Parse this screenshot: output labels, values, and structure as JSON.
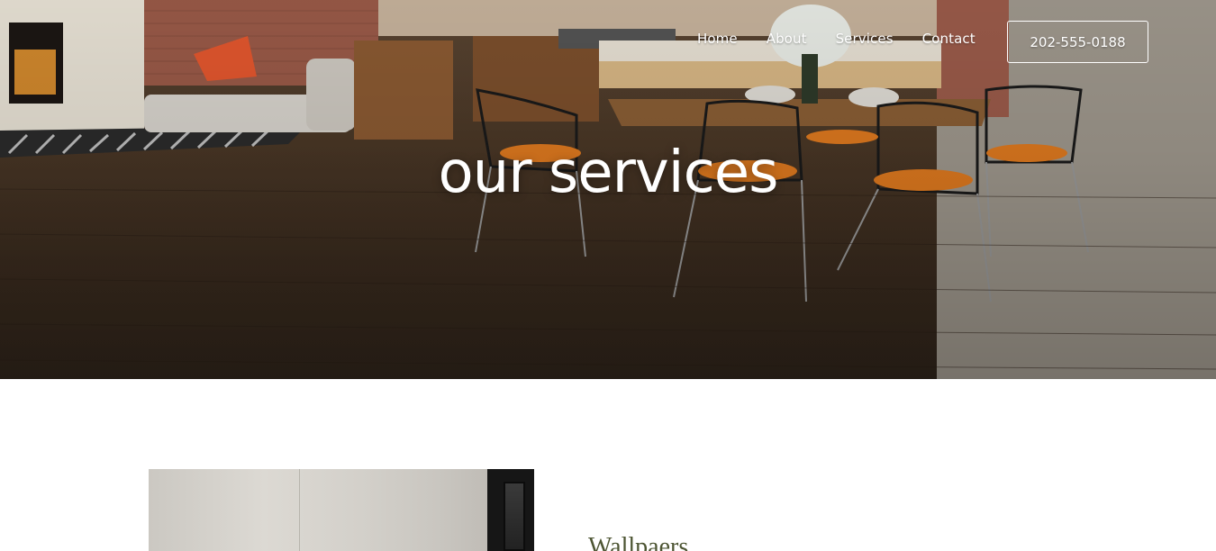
{
  "nav": {
    "items": [
      {
        "label": "Home"
      },
      {
        "label": "About"
      },
      {
        "label": "Services"
      },
      {
        "label": "Contact"
      }
    ],
    "phone_button": "202-555-0188"
  },
  "hero": {
    "title": "our services",
    "image_subject": "modern-kitchen-dining-interior"
  },
  "services": {
    "first": {
      "heading": "Wallpaers",
      "image_subject": "textured-wallpaper-wall"
    }
  },
  "colors": {
    "heading_text": "#4d5533",
    "hero_text": "#ffffff",
    "page_background": "#ffffff"
  }
}
